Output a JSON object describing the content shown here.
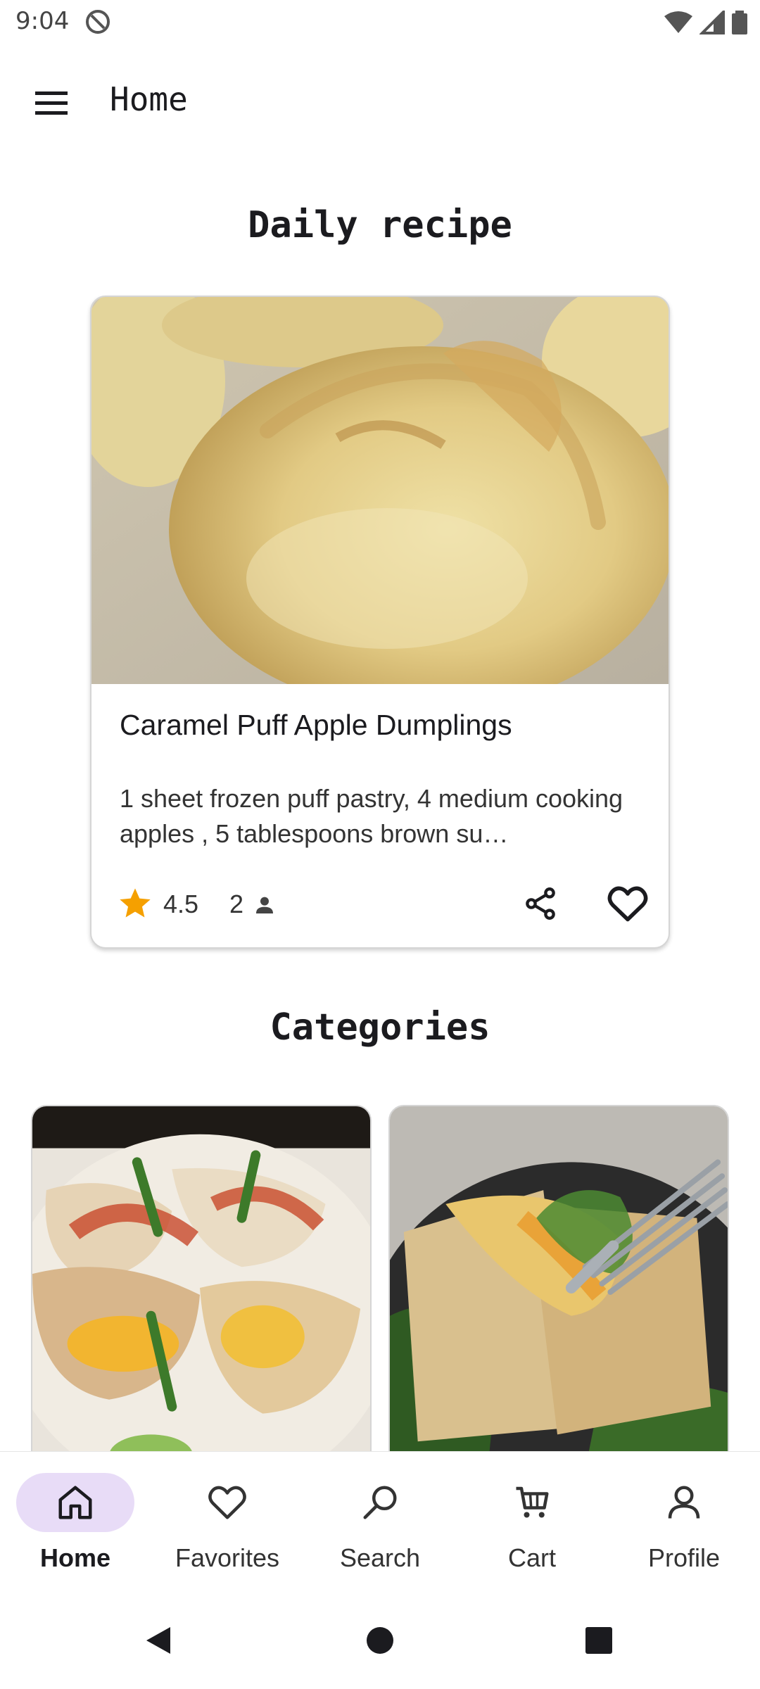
{
  "status_bar": {
    "time": "9:04"
  },
  "app_bar": {
    "title": "Home",
    "menu_icon": "menu-icon"
  },
  "daily": {
    "section_title": "Daily recipe",
    "recipe_name": "Caramel Puff Apple Dumplings",
    "ingredients": "1 sheet frozen puff pastry, 4 medium cooking apples , 5 tablespoons brown su…",
    "rating": "4.5",
    "reviews": "2",
    "rating_star_color": "#f5a000"
  },
  "categories": {
    "section_title": "Categories",
    "items": [
      {
        "image": "ravioli-dish-photo"
      },
      {
        "image": "ravioli-greens-photo"
      }
    ]
  },
  "bottom_nav": {
    "active": "Home",
    "active_color": "#e8dcf7",
    "items": [
      {
        "label": "Home",
        "icon": "home-icon"
      },
      {
        "label": "Favorites",
        "icon": "heart-icon"
      },
      {
        "label": "Search",
        "icon": "search-icon"
      },
      {
        "label": "Cart",
        "icon": "cart-icon"
      },
      {
        "label": "Profile",
        "icon": "person-icon"
      }
    ]
  }
}
